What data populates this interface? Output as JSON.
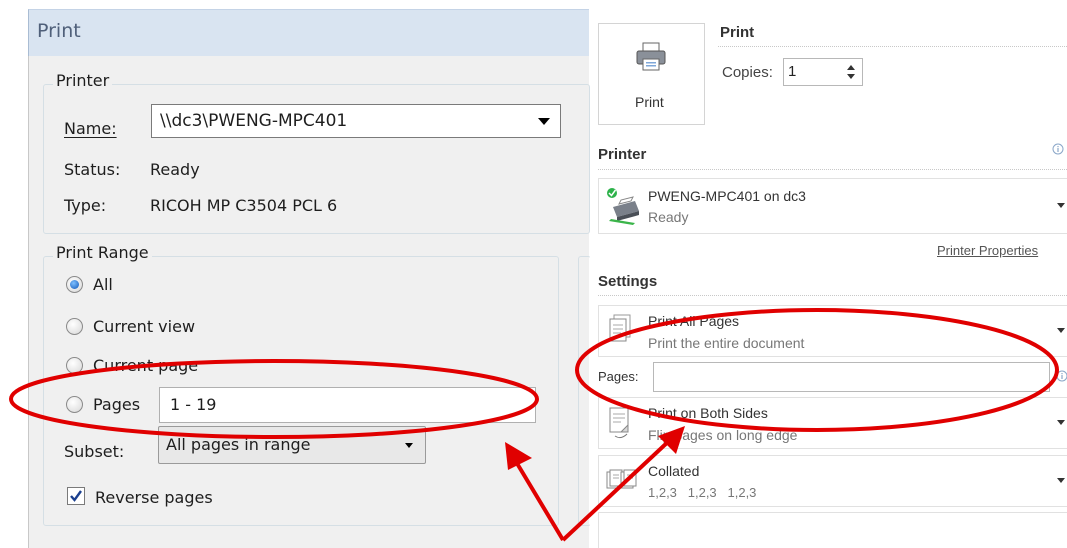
{
  "left_dialog": {
    "title": "Print",
    "printer_group": {
      "title": "Printer",
      "name_label": "Name:",
      "name_value": "\\\\dc3\\PWENG-MPC401",
      "status_label": "Status:",
      "status_value": "Ready",
      "type_label": "Type:",
      "type_value": "RICOH MP C3504 PCL 6"
    },
    "range_group": {
      "title": "Print Range",
      "options": [
        "All",
        "Current view",
        "Current page",
        "Pages"
      ],
      "selected": "All",
      "pages_value": "1 - 19",
      "subset_label": "Subset:",
      "subset_value": "All pages in range",
      "reverse_label": "Reverse pages",
      "reverse_checked": true
    }
  },
  "right_pane": {
    "print_button_label": "Print",
    "print_heading": "Print",
    "copies_label": "Copies:",
    "copies_value": "1",
    "printer_heading": "Printer",
    "printer_name": "PWENG-MPC401 on dc3",
    "printer_status": "Ready",
    "printer_properties_link": "Printer Properties",
    "settings_heading": "Settings",
    "print_what": {
      "title": "Print All Pages",
      "subtitle": "Print the entire document"
    },
    "pages_label": "Pages:",
    "pages_value": "",
    "sides": {
      "title": "Print on Both Sides",
      "subtitle": "Flip pages on long edge"
    },
    "collation": {
      "title": "Collated",
      "subtitle": "1,2,3   1,2,3   1,2,3"
    }
  },
  "annotation": {
    "color": "#e00000"
  }
}
